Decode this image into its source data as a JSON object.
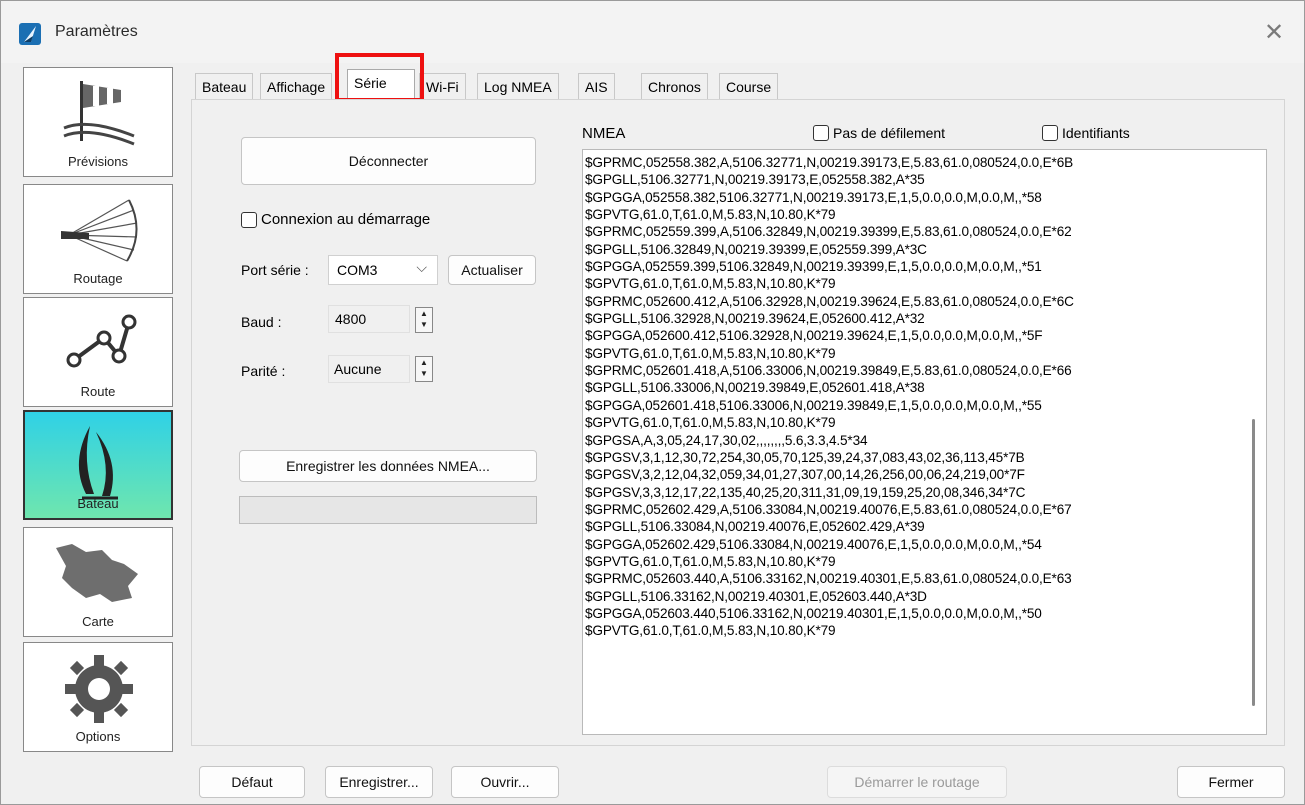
{
  "window": {
    "title": "Paramètres"
  },
  "sidebar": {
    "items": [
      {
        "label": "Prévisions",
        "icon": "windsock-icon"
      },
      {
        "label": "Routage",
        "icon": "routing-fan-icon"
      },
      {
        "label": "Route",
        "icon": "route-waypoints-icon"
      },
      {
        "label": "Bateau",
        "icon": "sailboat-icon",
        "active": true
      },
      {
        "label": "Carte",
        "icon": "map-region-icon"
      },
      {
        "label": "Options",
        "icon": "gear-icon"
      }
    ]
  },
  "tabs": [
    {
      "label": "Bateau"
    },
    {
      "label": "Affichage"
    },
    {
      "label": "Série",
      "active": true
    },
    {
      "label": "Wi-Fi"
    },
    {
      "label": "Log NMEA"
    },
    {
      "label": "AIS"
    },
    {
      "label": "Chronos"
    },
    {
      "label": "Course"
    }
  ],
  "serial": {
    "disconnect_label": "Déconnecter",
    "connect_on_start_label": "Connexion au démarrage",
    "port_label": "Port série :",
    "port_value": "COM3",
    "refresh_label": "Actualiser",
    "baud_label": "Baud :",
    "baud_value": "4800",
    "parity_label": "Parité :",
    "parity_value": "Aucune",
    "record_label": "Enregistrer les données NMEA..."
  },
  "nmea": {
    "title": "NMEA",
    "no_scroll_label": "Pas de défilement",
    "identifiers_label": "Identifiants",
    "lines": [
      "$GPRMC,052558.382,A,5106.32771,N,00219.39173,E,5.83,61.0,080524,0.0,E*6B",
      "$GPGLL,5106.32771,N,00219.39173,E,052558.382,A*35",
      "$GPGGA,052558.382,5106.32771,N,00219.39173,E,1,5,0.0,0.0,M,0.0,M,,*58",
      "$GPVTG,61.0,T,61.0,M,5.83,N,10.80,K*79",
      "$GPRMC,052559.399,A,5106.32849,N,00219.39399,E,5.83,61.0,080524,0.0,E*62",
      "$GPGLL,5106.32849,N,00219.39399,E,052559.399,A*3C",
      "$GPGGA,052559.399,5106.32849,N,00219.39399,E,1,5,0.0,0.0,M,0.0,M,,*51",
      "$GPVTG,61.0,T,61.0,M,5.83,N,10.80,K*79",
      "$GPRMC,052600.412,A,5106.32928,N,00219.39624,E,5.83,61.0,080524,0.0,E*6C",
      "$GPGLL,5106.32928,N,00219.39624,E,052600.412,A*32",
      "$GPGGA,052600.412,5106.32928,N,00219.39624,E,1,5,0.0,0.0,M,0.0,M,,*5F",
      "$GPVTG,61.0,T,61.0,M,5.83,N,10.80,K*79",
      "$GPRMC,052601.418,A,5106.33006,N,00219.39849,E,5.83,61.0,080524,0.0,E*66",
      "$GPGLL,5106.33006,N,00219.39849,E,052601.418,A*38",
      "$GPGGA,052601.418,5106.33006,N,00219.39849,E,1,5,0.0,0.0,M,0.0,M,,*55",
      "$GPVTG,61.0,T,61.0,M,5.83,N,10.80,K*79",
      "$GPGSA,A,3,05,24,17,30,02,,,,,,,,5.6,3.3,4.5*34",
      "$GPGSV,3,1,12,30,72,254,30,05,70,125,39,24,37,083,43,02,36,113,45*7B",
      "$GPGSV,3,2,12,04,32,059,34,01,27,307,00,14,26,256,00,06,24,219,00*7F",
      "$GPGSV,3,3,12,17,22,135,40,25,20,311,31,09,19,159,25,20,08,346,34*7C",
      "$GPRMC,052602.429,A,5106.33084,N,00219.40076,E,5.83,61.0,080524,0.0,E*67",
      "$GPGLL,5106.33084,N,00219.40076,E,052602.429,A*39",
      "$GPGGA,052602.429,5106.33084,N,00219.40076,E,1,5,0.0,0.0,M,0.0,M,,*54",
      "$GPVTG,61.0,T,61.0,M,5.83,N,10.80,K*79",
      "$GPRMC,052603.440,A,5106.33162,N,00219.40301,E,5.83,61.0,080524,0.0,E*63",
      "$GPGLL,5106.33162,N,00219.40301,E,052603.440,A*3D",
      "$GPGGA,052603.440,5106.33162,N,00219.40301,E,1,5,0.0,0.0,M,0.0,M,,*50",
      "$GPVTG,61.0,T,61.0,M,5.83,N,10.80,K*79"
    ]
  },
  "footer": {
    "default_label": "Défaut",
    "save_label": "Enregistrer...",
    "open_label": "Ouvrir...",
    "start_routing_label": "Démarrer le routage",
    "close_label": "Fermer"
  },
  "colors": {
    "active_tab_highlight": "#ee1010",
    "active_sidebar_top": "#2fd1e6",
    "active_sidebar_bottom": "#6fe6ae"
  }
}
